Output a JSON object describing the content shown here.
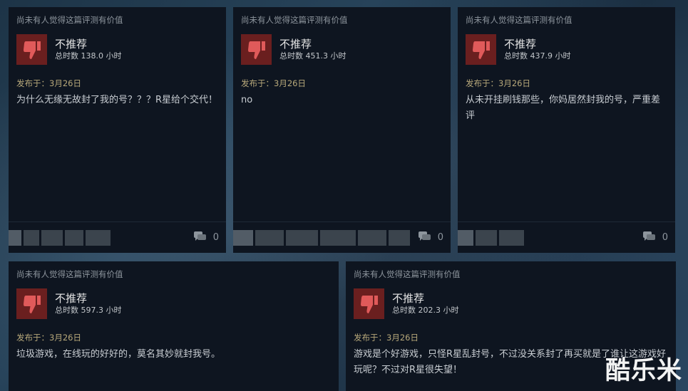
{
  "reviews": [
    {
      "helpful": "尚未有人觉得这篇评测有价值",
      "verdict": "不推荐",
      "hours": "总时数 138.0 小时",
      "posted": "发布于：3月26日",
      "text": "为什么无缘无故封了我的号？？？R星给个交代！",
      "comments": "0"
    },
    {
      "helpful": "尚未有人觉得这篇评测有价值",
      "verdict": "不推荐",
      "hours": "总时数 451.3 小时",
      "posted": "发布于：3月26日",
      "text": "no",
      "comments": "0"
    },
    {
      "helpful": "尚未有人觉得这篇评测有价值",
      "verdict": "不推荐",
      "hours": "总时数 437.9 小时",
      "posted": "发布于：3月26日",
      "text": "从未开挂刷钱那些，你妈居然封我的号，严重差评",
      "comments": "0"
    },
    {
      "helpful": "尚未有人觉得这篇评测有价值",
      "verdict": "不推荐",
      "hours": "总时数 597.3 小时",
      "posted": "发布于：3月26日",
      "text": "垃圾游戏，在线玩的好好的，莫名其妙就封我号。",
      "comments": ""
    },
    {
      "helpful": "尚未有人觉得这篇评测有价值",
      "verdict": "不推荐",
      "hours": "总时数 202.3 小时",
      "posted": "发布于：3月26日",
      "text": "游戏是个好游戏，只怪R星乱封号，不过没关系封了再买就是了谁让这游戏好玩呢？不过对R星很失望！",
      "comments": ""
    }
  ],
  "watermark": "酷乐米",
  "colors": {
    "card_bg": "#0e1520",
    "thumb_bg": "#6a1f1f",
    "thumb_icon": "#e05a5a",
    "date_text": "#b7a87a"
  }
}
